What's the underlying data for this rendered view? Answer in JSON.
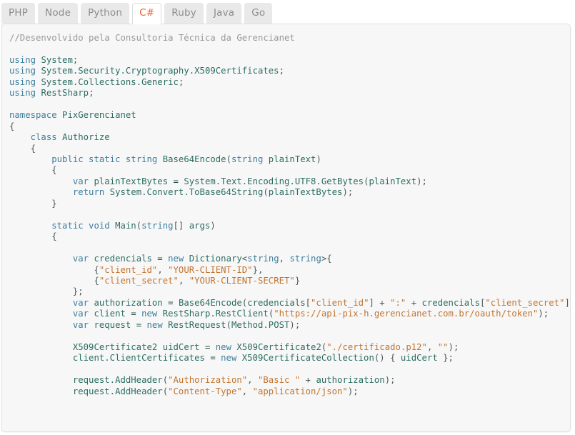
{
  "tabs": [
    {
      "label": "PHP",
      "active": false
    },
    {
      "label": "Node",
      "active": false
    },
    {
      "label": "Python",
      "active": false
    },
    {
      "label": "C#",
      "active": true
    },
    {
      "label": "Ruby",
      "active": false
    },
    {
      "label": "Java",
      "active": false
    },
    {
      "label": "Go",
      "active": false
    }
  ],
  "colors": {
    "active_tab_text": "#f05a28",
    "inactive_tab_text": "#8c8c8c",
    "inactive_tab_bg": "#e9e9e9",
    "panel_bg": "#f7f7f7",
    "panel_border": "#e0e0e0",
    "comment": "#999999",
    "keyword": "#3d7f9e",
    "type": "#2c6e63",
    "string": "#c2752f"
  },
  "code": {
    "language": "C#",
    "lines": [
      {
        "indent": 0,
        "tokens": [
          {
            "t": "c",
            "v": "//Desenvolvido pela Consultoria Técnica da Gerencianet"
          }
        ]
      },
      {
        "indent": 0,
        "tokens": []
      },
      {
        "indent": 0,
        "tokens": [
          {
            "t": "k",
            "v": "using"
          },
          {
            "t": "n",
            "v": " "
          },
          {
            "t": "t",
            "v": "System"
          },
          {
            "t": "p",
            "v": ";"
          }
        ]
      },
      {
        "indent": 0,
        "tokens": [
          {
            "t": "k",
            "v": "using"
          },
          {
            "t": "n",
            "v": " "
          },
          {
            "t": "t",
            "v": "System.Security.Cryptography.X509Certificates"
          },
          {
            "t": "p",
            "v": ";"
          }
        ]
      },
      {
        "indent": 0,
        "tokens": [
          {
            "t": "k",
            "v": "using"
          },
          {
            "t": "n",
            "v": " "
          },
          {
            "t": "t",
            "v": "System.Collections.Generic"
          },
          {
            "t": "p",
            "v": ";"
          }
        ]
      },
      {
        "indent": 0,
        "tokens": [
          {
            "t": "k",
            "v": "using"
          },
          {
            "t": "n",
            "v": " "
          },
          {
            "t": "t",
            "v": "RestSharp"
          },
          {
            "t": "p",
            "v": ";"
          }
        ]
      },
      {
        "indent": 0,
        "tokens": []
      },
      {
        "indent": 0,
        "tokens": [
          {
            "t": "k",
            "v": "namespace"
          },
          {
            "t": "n",
            "v": " "
          },
          {
            "t": "t",
            "v": "PixGerencianet"
          }
        ]
      },
      {
        "indent": 0,
        "tokens": [
          {
            "t": "p",
            "v": "{"
          }
        ]
      },
      {
        "indent": 1,
        "tokens": [
          {
            "t": "k",
            "v": "class"
          },
          {
            "t": "n",
            "v": " "
          },
          {
            "t": "t",
            "v": "Authorize"
          }
        ]
      },
      {
        "indent": 1,
        "tokens": [
          {
            "t": "p",
            "v": "{"
          }
        ]
      },
      {
        "indent": 2,
        "tokens": [
          {
            "t": "k",
            "v": "public static string"
          },
          {
            "t": "n",
            "v": " "
          },
          {
            "t": "t",
            "v": "Base64Encode"
          },
          {
            "t": "p",
            "v": "("
          },
          {
            "t": "k",
            "v": "string"
          },
          {
            "t": "n",
            "v": " "
          },
          {
            "t": "t",
            "v": "plainText"
          },
          {
            "t": "p",
            "v": ")"
          }
        ]
      },
      {
        "indent": 2,
        "tokens": [
          {
            "t": "p",
            "v": "{"
          }
        ]
      },
      {
        "indent": 3,
        "tokens": [
          {
            "t": "k",
            "v": "var"
          },
          {
            "t": "n",
            "v": " "
          },
          {
            "t": "t",
            "v": "plainTextBytes"
          },
          {
            "t": "n",
            "v": " = "
          },
          {
            "t": "t",
            "v": "System.Text.Encoding.UTF8.GetBytes"
          },
          {
            "t": "p",
            "v": "("
          },
          {
            "t": "t",
            "v": "plainText"
          },
          {
            "t": "p",
            "v": ");"
          }
        ]
      },
      {
        "indent": 3,
        "tokens": [
          {
            "t": "k",
            "v": "return"
          },
          {
            "t": "n",
            "v": " "
          },
          {
            "t": "t",
            "v": "System.Convert.ToBase64String"
          },
          {
            "t": "p",
            "v": "("
          },
          {
            "t": "t",
            "v": "plainTextBytes"
          },
          {
            "t": "p",
            "v": ");"
          }
        ]
      },
      {
        "indent": 2,
        "tokens": [
          {
            "t": "p",
            "v": "}"
          }
        ]
      },
      {
        "indent": 0,
        "tokens": []
      },
      {
        "indent": 2,
        "tokens": [
          {
            "t": "k",
            "v": "static void"
          },
          {
            "t": "n",
            "v": " "
          },
          {
            "t": "t",
            "v": "Main"
          },
          {
            "t": "p",
            "v": "("
          },
          {
            "t": "k",
            "v": "string"
          },
          {
            "t": "p",
            "v": "[]"
          },
          {
            "t": "n",
            "v": " "
          },
          {
            "t": "t",
            "v": "args"
          },
          {
            "t": "p",
            "v": ")"
          }
        ]
      },
      {
        "indent": 2,
        "tokens": [
          {
            "t": "p",
            "v": "{"
          }
        ]
      },
      {
        "indent": 0,
        "tokens": []
      },
      {
        "indent": 3,
        "tokens": [
          {
            "t": "k",
            "v": "var"
          },
          {
            "t": "n",
            "v": " "
          },
          {
            "t": "t",
            "v": "credencials"
          },
          {
            "t": "n",
            "v": " = "
          },
          {
            "t": "k",
            "v": "new"
          },
          {
            "t": "n",
            "v": " "
          },
          {
            "t": "t",
            "v": "Dictionary"
          },
          {
            "t": "p",
            "v": "<"
          },
          {
            "t": "k",
            "v": "string"
          },
          {
            "t": "p",
            "v": ", "
          },
          {
            "t": "k",
            "v": "string"
          },
          {
            "t": "p",
            "v": ">{"
          }
        ]
      },
      {
        "indent": 4,
        "tokens": [
          {
            "t": "p",
            "v": "{"
          },
          {
            "t": "s",
            "v": "\"client_id\""
          },
          {
            "t": "p",
            "v": ", "
          },
          {
            "t": "s",
            "v": "\"YOUR-CLIENT-ID\""
          },
          {
            "t": "p",
            "v": "},"
          }
        ]
      },
      {
        "indent": 4,
        "tokens": [
          {
            "t": "p",
            "v": "{"
          },
          {
            "t": "s",
            "v": "\"client_secret\""
          },
          {
            "t": "p",
            "v": ", "
          },
          {
            "t": "s",
            "v": "\"YOUR-CLIENT-SECRET\""
          },
          {
            "t": "p",
            "v": "}"
          }
        ]
      },
      {
        "indent": 3,
        "tokens": [
          {
            "t": "p",
            "v": "};"
          }
        ]
      },
      {
        "indent": 3,
        "tokens": [
          {
            "t": "k",
            "v": "var"
          },
          {
            "t": "n",
            "v": " "
          },
          {
            "t": "t",
            "v": "authorization"
          },
          {
            "t": "n",
            "v": " = "
          },
          {
            "t": "t",
            "v": "Base64Encode"
          },
          {
            "t": "p",
            "v": "("
          },
          {
            "t": "t",
            "v": "credencials"
          },
          {
            "t": "p",
            "v": "["
          },
          {
            "t": "s",
            "v": "\"client_id\""
          },
          {
            "t": "p",
            "v": "] + "
          },
          {
            "t": "s",
            "v": "\":\""
          },
          {
            "t": "p",
            "v": " + "
          },
          {
            "t": "t",
            "v": "credencials"
          },
          {
            "t": "p",
            "v": "["
          },
          {
            "t": "s",
            "v": "\"client_secret\""
          },
          {
            "t": "p",
            "v": "]);"
          }
        ]
      },
      {
        "indent": 3,
        "tokens": [
          {
            "t": "k",
            "v": "var"
          },
          {
            "t": "n",
            "v": " "
          },
          {
            "t": "t",
            "v": "client"
          },
          {
            "t": "n",
            "v": " = "
          },
          {
            "t": "k",
            "v": "new"
          },
          {
            "t": "n",
            "v": " "
          },
          {
            "t": "t",
            "v": "RestSharp.RestClient"
          },
          {
            "t": "p",
            "v": "("
          },
          {
            "t": "s",
            "v": "\"https://api-pix-h.gerencianet.com.br/oauth/token\""
          },
          {
            "t": "p",
            "v": ");"
          }
        ]
      },
      {
        "indent": 3,
        "tokens": [
          {
            "t": "k",
            "v": "var"
          },
          {
            "t": "n",
            "v": " "
          },
          {
            "t": "t",
            "v": "request"
          },
          {
            "t": "n",
            "v": " = "
          },
          {
            "t": "k",
            "v": "new"
          },
          {
            "t": "n",
            "v": " "
          },
          {
            "t": "t",
            "v": "RestRequest"
          },
          {
            "t": "p",
            "v": "("
          },
          {
            "t": "t",
            "v": "Method.POST"
          },
          {
            "t": "p",
            "v": ");"
          }
        ]
      },
      {
        "indent": 0,
        "tokens": []
      },
      {
        "indent": 3,
        "tokens": [
          {
            "t": "t",
            "v": "X509Certificate2"
          },
          {
            "t": "n",
            "v": " "
          },
          {
            "t": "t",
            "v": "uidCert"
          },
          {
            "t": "n",
            "v": " = "
          },
          {
            "t": "k",
            "v": "new"
          },
          {
            "t": "n",
            "v": " "
          },
          {
            "t": "t",
            "v": "X509Certificate2"
          },
          {
            "t": "p",
            "v": "("
          },
          {
            "t": "s",
            "v": "\"./certificado.p12\""
          },
          {
            "t": "p",
            "v": ", "
          },
          {
            "t": "s",
            "v": "\"\""
          },
          {
            "t": "p",
            "v": ");"
          }
        ]
      },
      {
        "indent": 3,
        "tokens": [
          {
            "t": "t",
            "v": "client.ClientCertificates"
          },
          {
            "t": "n",
            "v": " = "
          },
          {
            "t": "k",
            "v": "new"
          },
          {
            "t": "n",
            "v": " "
          },
          {
            "t": "t",
            "v": "X509CertificateCollection"
          },
          {
            "t": "p",
            "v": "() { "
          },
          {
            "t": "t",
            "v": "uidCert"
          },
          {
            "t": "p",
            "v": " };"
          }
        ]
      },
      {
        "indent": 0,
        "tokens": []
      },
      {
        "indent": 3,
        "tokens": [
          {
            "t": "t",
            "v": "request.AddHeader"
          },
          {
            "t": "p",
            "v": "("
          },
          {
            "t": "s",
            "v": "\"Authorization\""
          },
          {
            "t": "p",
            "v": ", "
          },
          {
            "t": "s",
            "v": "\"Basic \""
          },
          {
            "t": "p",
            "v": " + "
          },
          {
            "t": "t",
            "v": "authorization"
          },
          {
            "t": "p",
            "v": ");"
          }
        ]
      },
      {
        "indent": 3,
        "tokens": [
          {
            "t": "t",
            "v": "request.AddHeader"
          },
          {
            "t": "p",
            "v": "("
          },
          {
            "t": "s",
            "v": "\"Content-Type\""
          },
          {
            "t": "p",
            "v": ", "
          },
          {
            "t": "s",
            "v": "\"application/json\""
          },
          {
            "t": "p",
            "v": ");"
          }
        ]
      }
    ]
  }
}
